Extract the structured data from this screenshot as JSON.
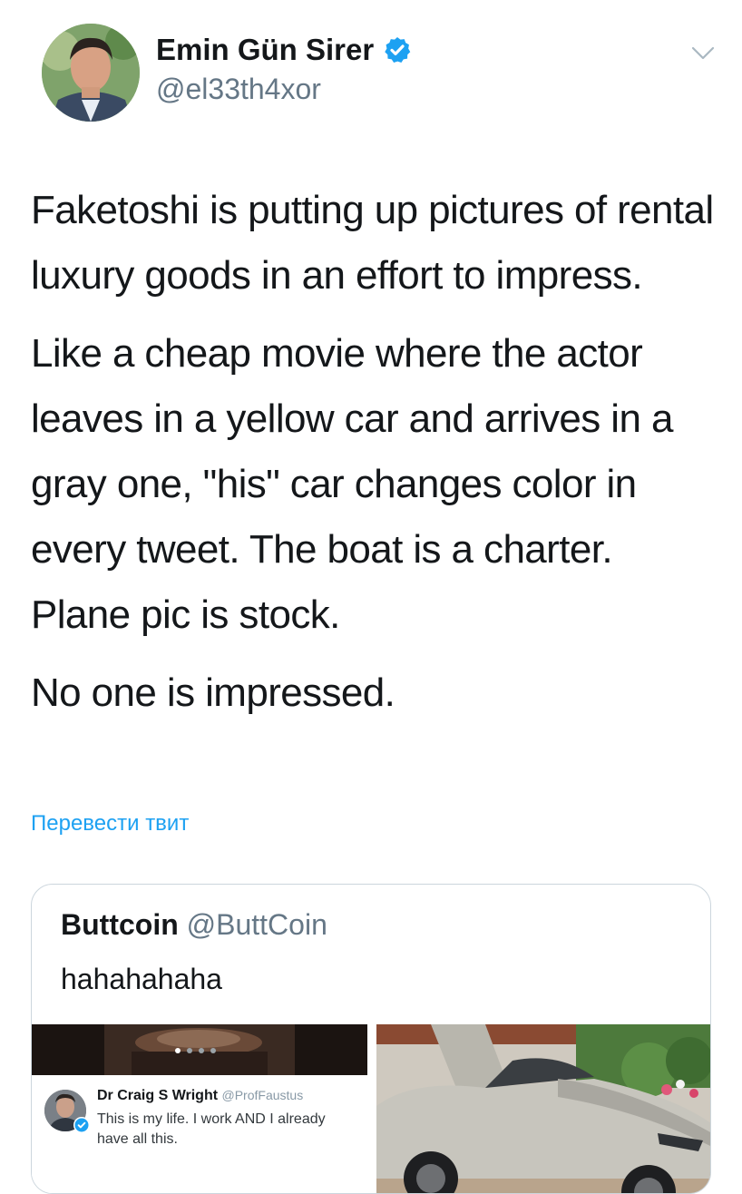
{
  "author": {
    "name": "Emin Gün Sirer",
    "handle": "@el33th4xor"
  },
  "tweet": {
    "paragraphs": [
      "Faketoshi is putting up pictures of rental luxury goods in an effort to impress.",
      "Like a cheap movie where the actor leaves in a yellow car and arrives in a gray one, \"his\" car changes color in every tweet. The boat is a charter. Plane pic is stock.",
      "No one is impressed."
    ],
    "translate_label": "Перевести твит"
  },
  "quoted": {
    "name": "Buttcoin",
    "handle": "@ButtCoin",
    "text": "hahahahaha",
    "embedded": {
      "name": "Dr Craig S Wright",
      "handle": "@ProfFaustus",
      "text": "This is my life. I work AND I already have all this."
    }
  },
  "icons": {
    "verified": "verified-badge-icon",
    "menu": "chevron-down-icon"
  },
  "colors": {
    "accent": "#1da1f2",
    "secondary_text": "#657786",
    "border": "#ccd6dd"
  }
}
